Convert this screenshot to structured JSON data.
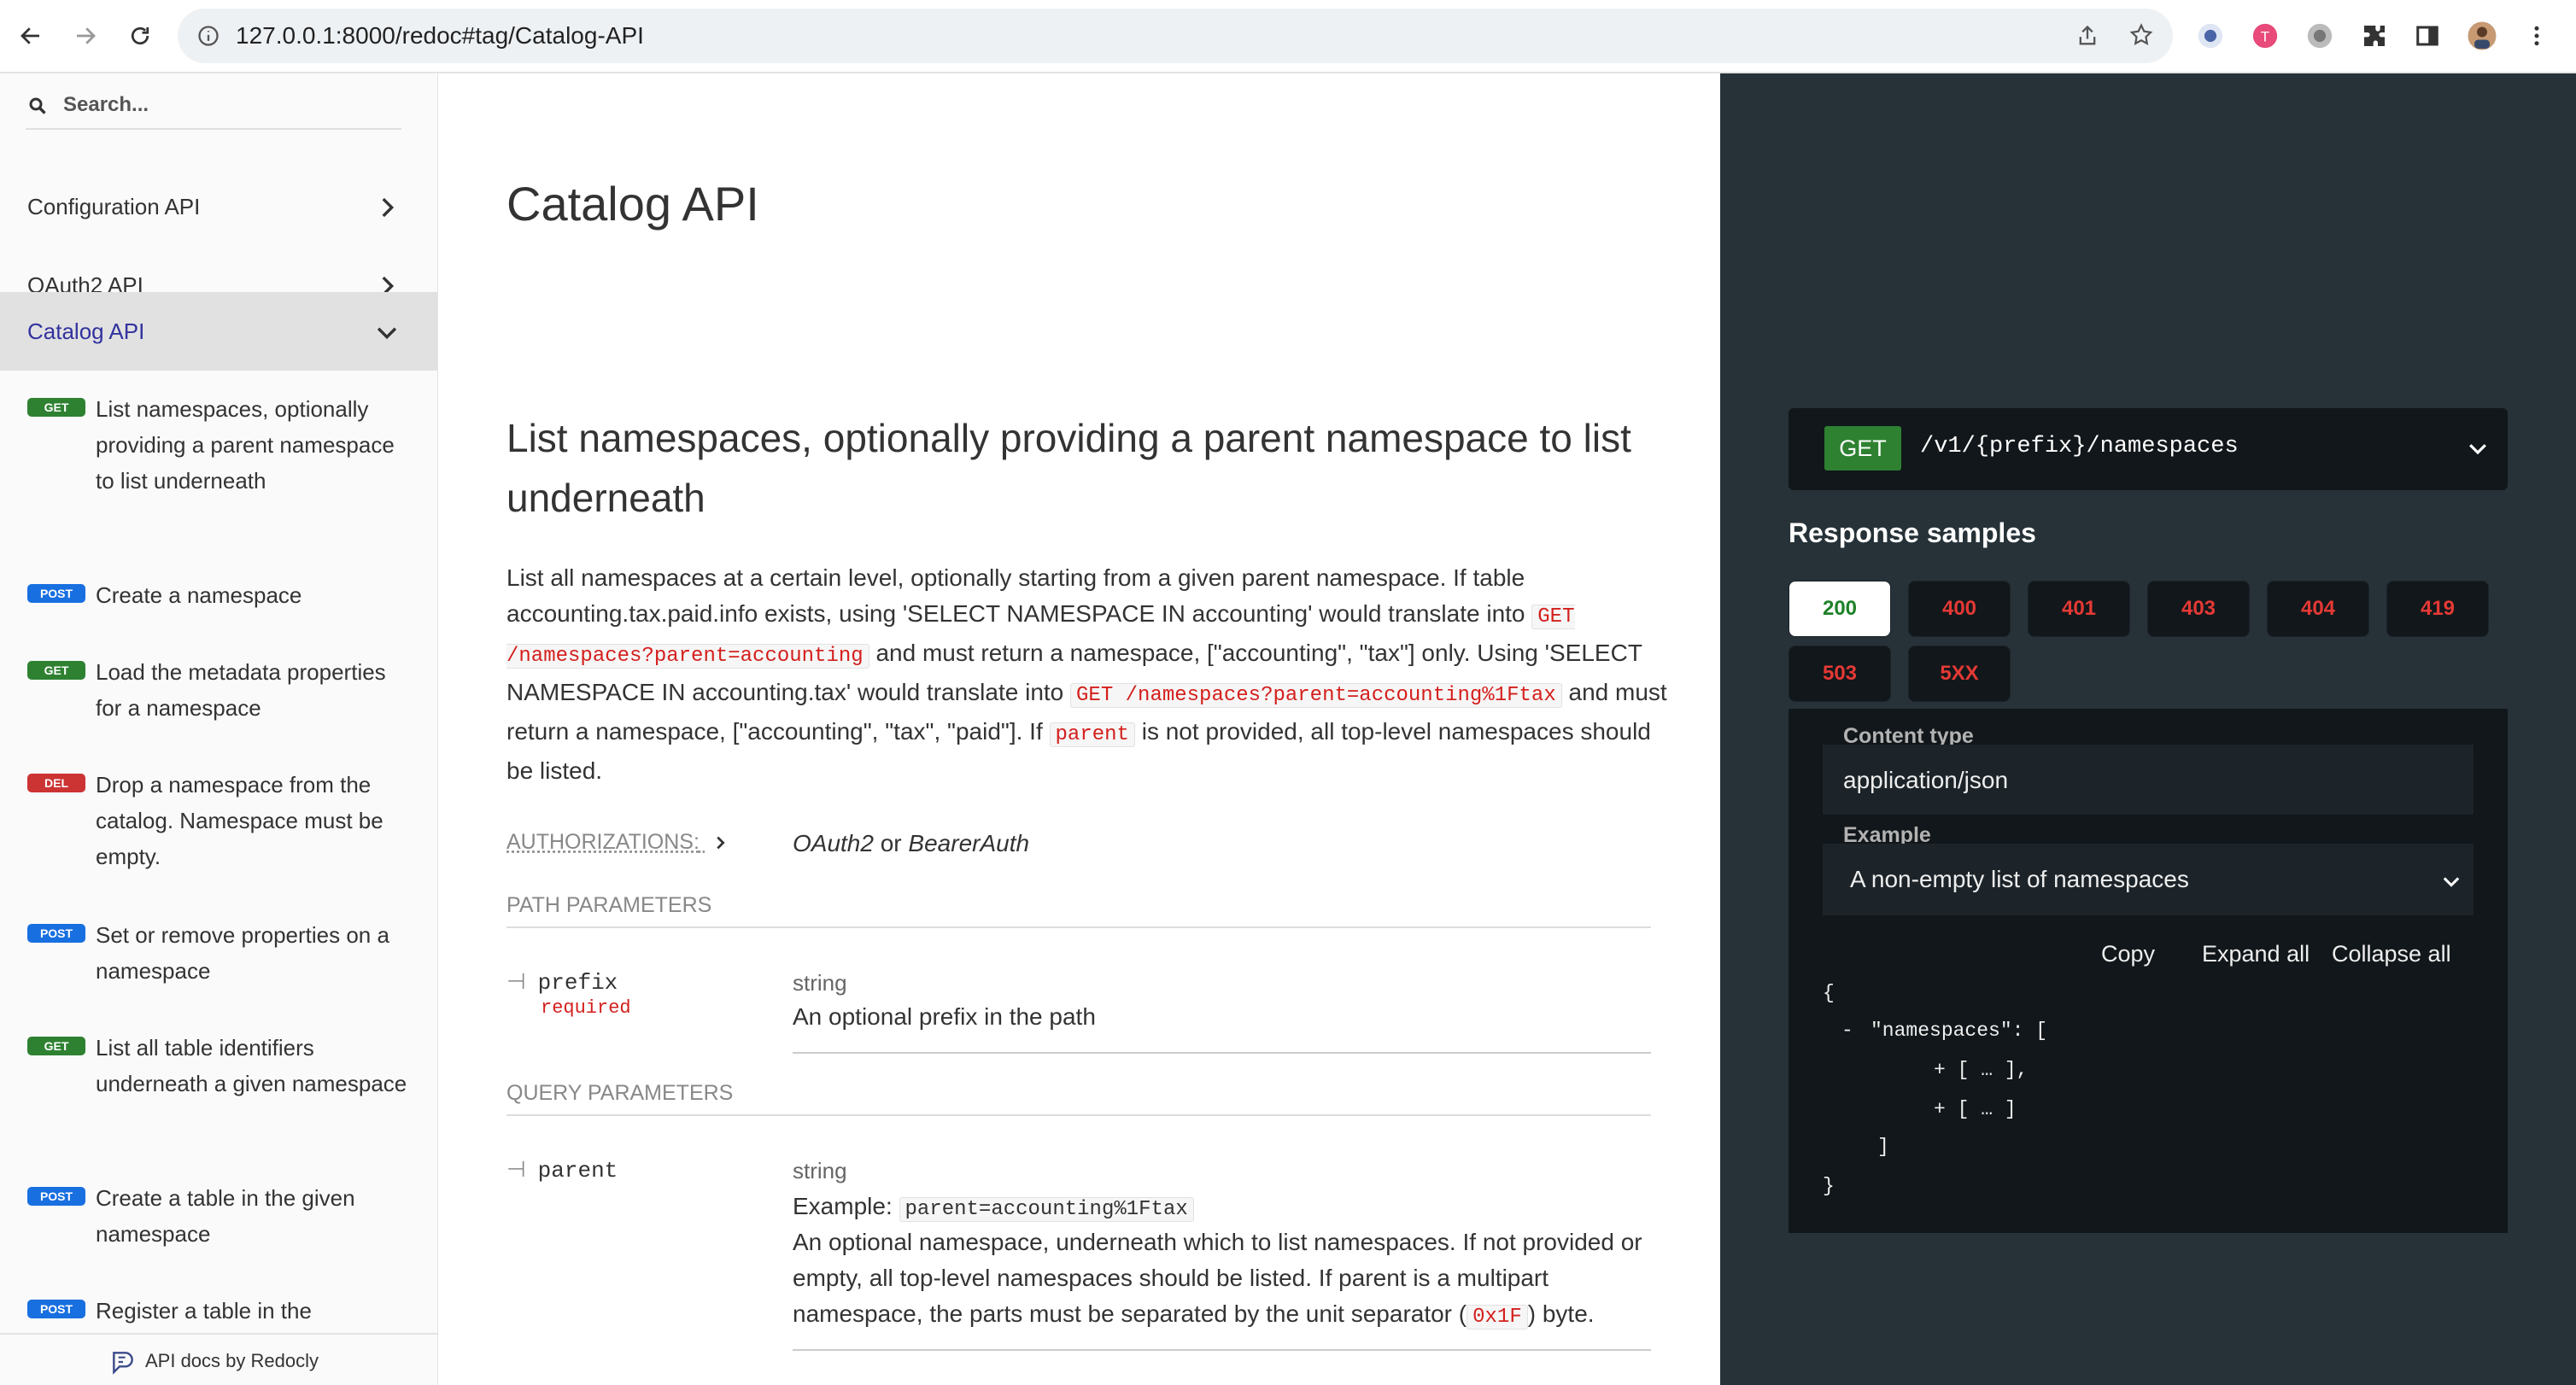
{
  "browser": {
    "url": "127.0.0.1:8000/redoc#tag/Catalog-API"
  },
  "sidebar": {
    "search_placeholder": "Search...",
    "categories": [
      {
        "label": "Configuration API"
      },
      {
        "label": "OAuth2 API"
      },
      {
        "label": "Catalog API"
      }
    ],
    "operations": [
      {
        "method": "GET",
        "label": "List namespaces, optionally providing a parent namespace to list underneath"
      },
      {
        "method": "POST",
        "label": "Create a namespace"
      },
      {
        "method": "GET",
        "label": "Load the metadata properties for a namespace"
      },
      {
        "method": "DEL",
        "label": "Drop a namespace from the catalog. Namespace must be empty."
      },
      {
        "method": "POST",
        "label": "Set or remove properties on a namespace"
      },
      {
        "method": "GET",
        "label": "List all table identifiers underneath a given namespace"
      },
      {
        "method": "POST",
        "label": "Create a table in the given namespace"
      },
      {
        "method": "POST",
        "label": "Register a table in the"
      }
    ],
    "footer": "API docs by Redocly"
  },
  "content": {
    "title": "Catalog API",
    "operation_title": "List namespaces, optionally providing a parent namespace to list underneath",
    "desc": {
      "p1": "List all namespaces at a certain level, optionally starting from a given parent namespace. If table accounting.tax.paid.info exists, using 'SELECT NAMESPACE IN accounting' would translate into",
      "code1": "GET /namespaces?parent=accounting",
      "p2": "and must return a namespace, [\"accounting\", \"tax\"] only. Using 'SELECT NAMESPACE IN accounting.tax' would translate into",
      "code2": "GET /namespaces?parent=accounting%1Ftax",
      "p3": "and must return a namespace, [\"accounting\", \"tax\", \"paid\"]. If",
      "code3": "parent",
      "p4": "is not provided, all top-level namespaces should be listed."
    },
    "authorizations": {
      "label": "AUTHORIZATIONS:",
      "opt1": "OAuth2",
      "or": "or",
      "opt2": "BearerAuth"
    },
    "path_params": {
      "title": "PATH PARAMETERS",
      "name": "prefix",
      "required": "required",
      "type": "string",
      "desc": "An optional prefix in the path"
    },
    "query_params": {
      "title": "QUERY PARAMETERS",
      "name": "parent",
      "type": "string",
      "example_label": "Example:",
      "example_value": "parent=accounting%1Ftax",
      "desc": "An optional namespace, underneath which to list namespaces. If not provided or empty, all top-level namespaces should be listed. If parent is a multipart namespace, the parts must be separated by the unit separator (",
      "desc_code": "0x1F",
      "desc_end": ") byte."
    }
  },
  "right_panel": {
    "method": "GET",
    "path": "/v1/{prefix}/namespaces",
    "response_title": "Response samples",
    "tabs": [
      "200",
      "400",
      "401",
      "403",
      "404",
      "419",
      "503",
      "5XX"
    ],
    "active_tab": "200",
    "content_type_label": "Content type",
    "content_type": "application/json",
    "example_label": "Example",
    "example_value": "A non-empty list of namespaces",
    "actions": {
      "copy": "Copy",
      "expand": "Expand all",
      "collapse": "Collapse all"
    },
    "json": {
      "open": "{",
      "toggle": "-",
      "key": "\"namespaces\": [",
      "item1": "+ [ … ],",
      "item2": "+ [ … ]",
      "close_arr": "]",
      "close": "}"
    }
  },
  "colors": {
    "get": "#2f8132",
    "post": "#186fe0",
    "delete": "#cc3333",
    "right_panel_bg": "#263238",
    "active_link": "#32329f"
  }
}
